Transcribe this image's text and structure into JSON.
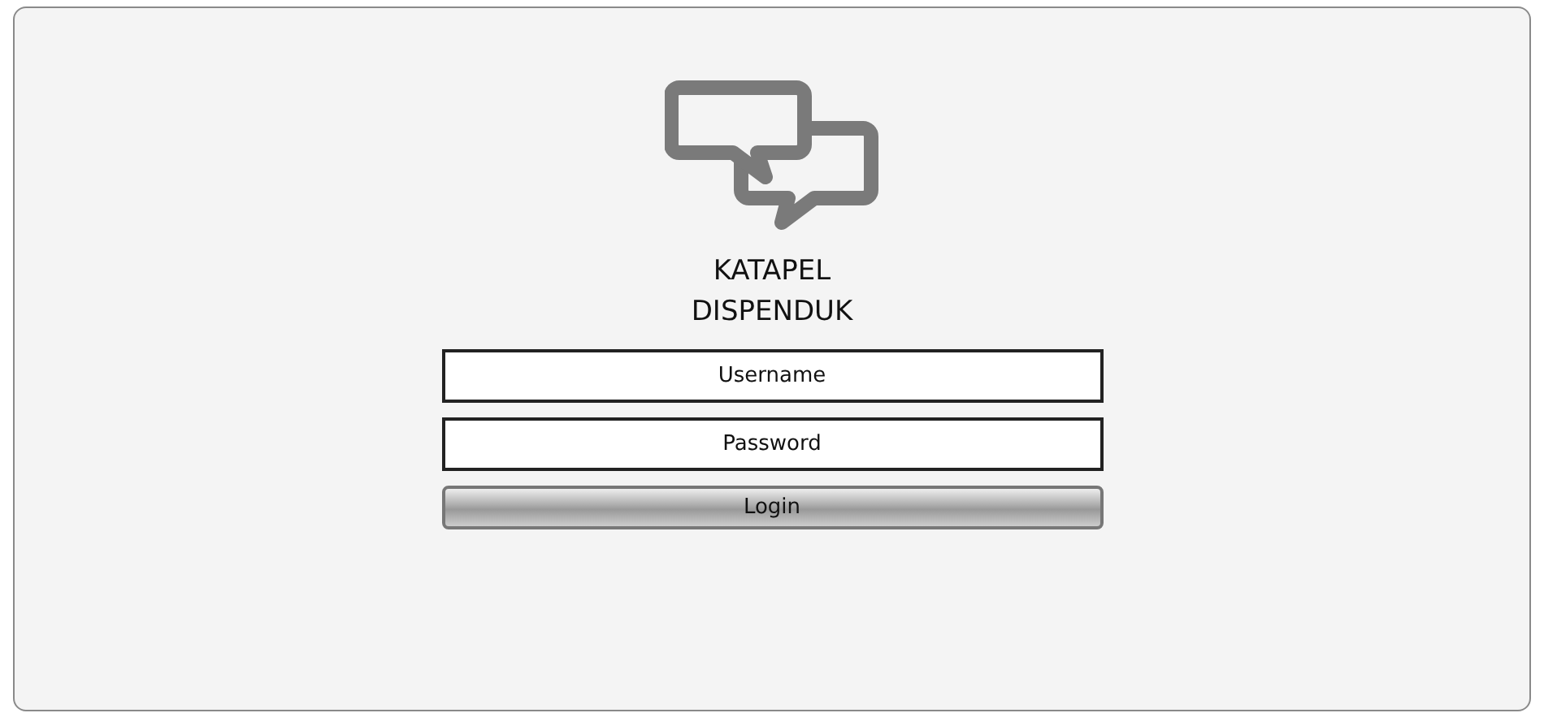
{
  "app": {
    "title_lines": [
      "KATAPEL",
      "DISPENDUK"
    ]
  },
  "form": {
    "username": {
      "placeholder": "Username"
    },
    "password": {
      "placeholder": "Password"
    },
    "submit": "Login"
  }
}
